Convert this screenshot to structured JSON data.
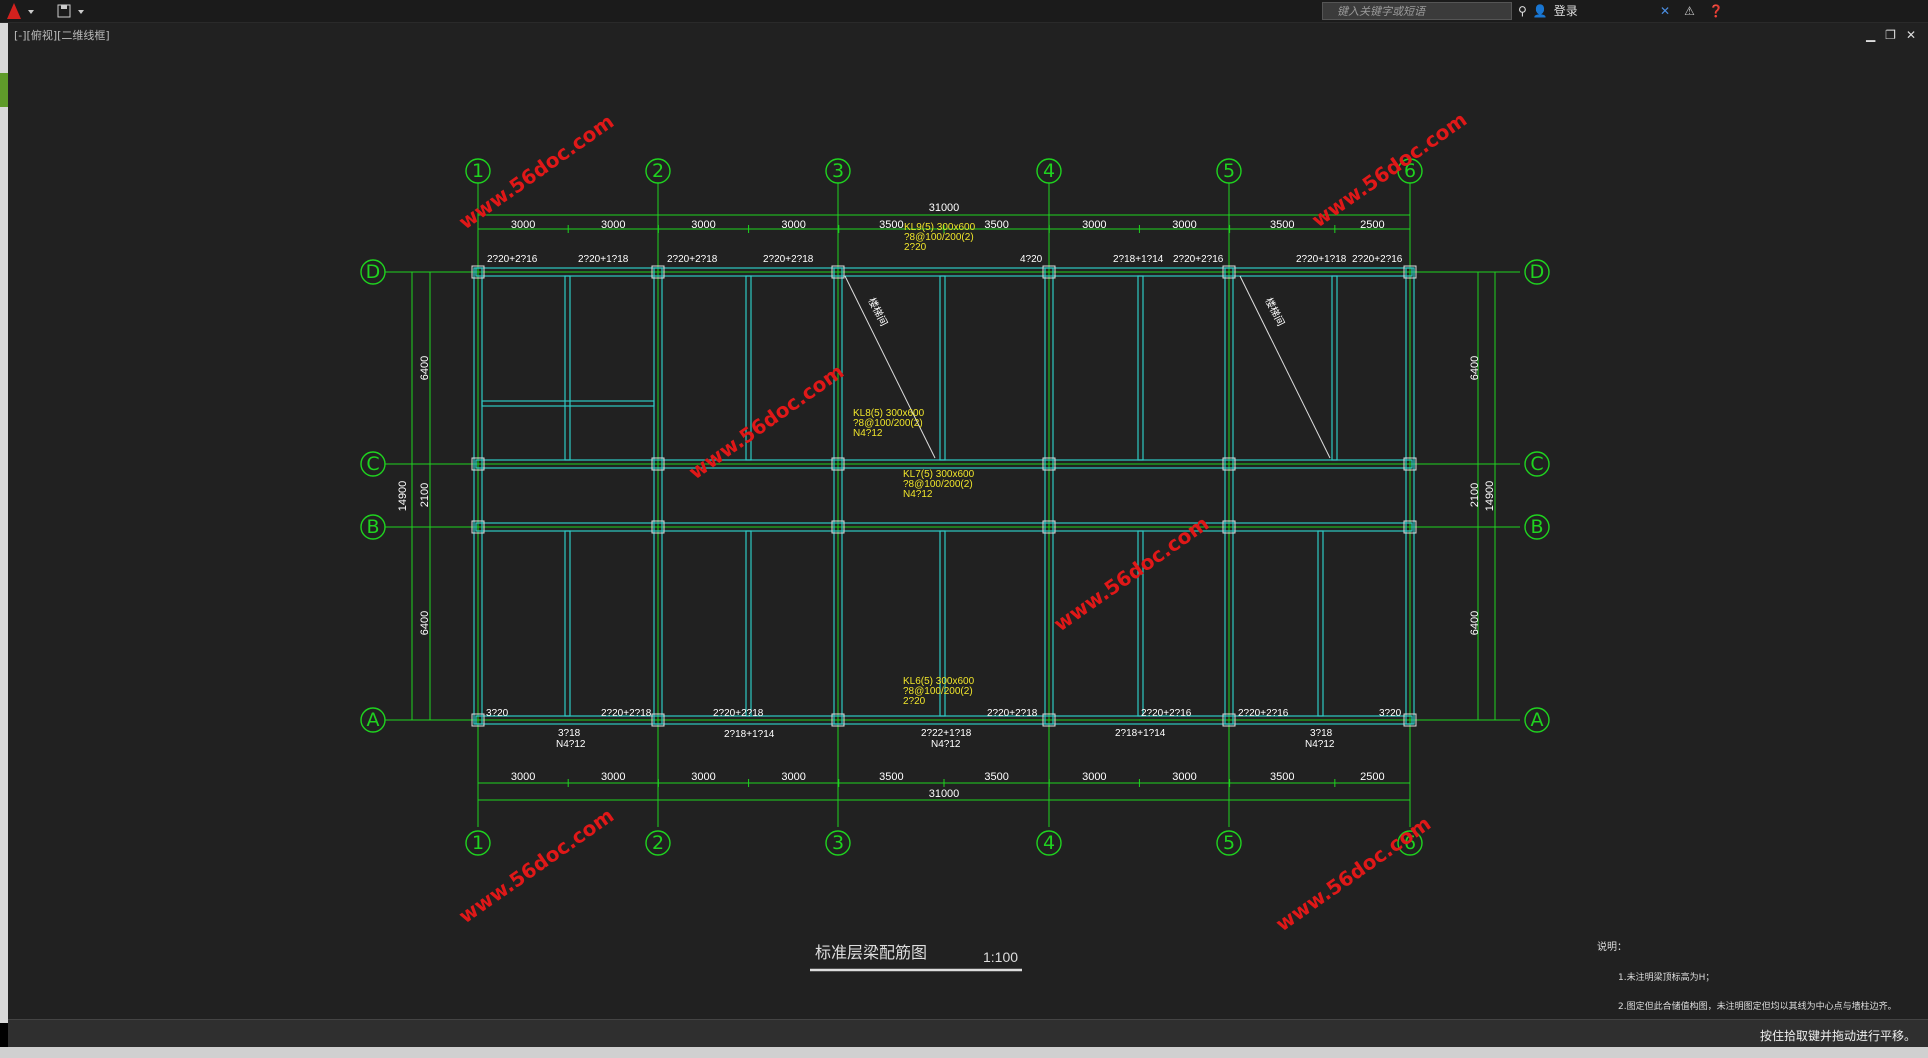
{
  "topbar": {
    "search_placeholder": "键入关键字或短语",
    "login_label": "登录"
  },
  "viewport": {
    "label": "[-][俯视][二维线框]"
  },
  "drawing": {
    "title": "标准层梁配筋图",
    "scale": "1:100",
    "col_axes": [
      "1",
      "2",
      "3",
      "4",
      "5",
      "6"
    ],
    "row_axes": [
      "D",
      "C",
      "B",
      "A"
    ],
    "top_dims": [
      "3000",
      "3000",
      "3000",
      "3000",
      "3500",
      "3500",
      "3000",
      "3000",
      "3500",
      "2500"
    ],
    "bottom_dims": [
      "3000",
      "3000",
      "3000",
      "3000",
      "3500",
      "3500",
      "3000",
      "3000",
      "3500",
      "2500"
    ],
    "total_width": "31000",
    "left_dims": [
      "6400",
      "2100",
      "6400"
    ],
    "total_height": "14900",
    "notes_title": "说明：",
    "notes": [
      "1.未注明梁顶标高为H；",
      "2.图定但此合储值构图，未注明图定但均以其线为中心点与墙柱边齐。"
    ],
    "beam_callouts": [
      "KL9(5) 300x600",
      "?8@100/200(2)",
      "2?20",
      "KL8(5) 300x600",
      "?8@100/200(2)",
      "N4?12",
      "KL7(5) 300x600",
      "?8@100/200(2)",
      "N4?12",
      "KL6(5) 300x600",
      "?8@100/200(2)",
      "2?20"
    ],
    "top_beam_labels": [
      "2?20+2?16",
      "2?20+1?18",
      "2?20+2?18",
      "2?20+2?18",
      "4?20",
      "2?18+1?14",
      "2?20+2?16",
      "2?20+1?18",
      "2?20+2?16"
    ],
    "bottom_beam_labels": [
      "3?20",
      "2?20+2?18",
      "2?20+2?18",
      "2?20+2?18",
      "2?20+2?16",
      "2?20+2?16",
      "3?20"
    ],
    "bottom_beam_below": [
      "3?18",
      "N4?12",
      "2?18+1?14",
      "2?22+1?18",
      "N4?12",
      "2?18+1?14",
      "3?18",
      "N4?12"
    ],
    "stair_label": "楼梯间"
  },
  "watermark": "www.56doc.com",
  "cmdline": {
    "hint": "按住拾取键并拖动进行平移。"
  },
  "colors": {
    "grid": "#1fd31f",
    "beam": "#2ec9c4",
    "callout": "#f0e52b",
    "watermark": "#e01818"
  },
  "icons": [
    "autocad-logo-icon",
    "save-icon",
    "binoculars-icon",
    "user-icon",
    "exchange-icon",
    "network-icon",
    "help-icon",
    "minimize-icon",
    "restore-icon",
    "close-icon"
  ]
}
